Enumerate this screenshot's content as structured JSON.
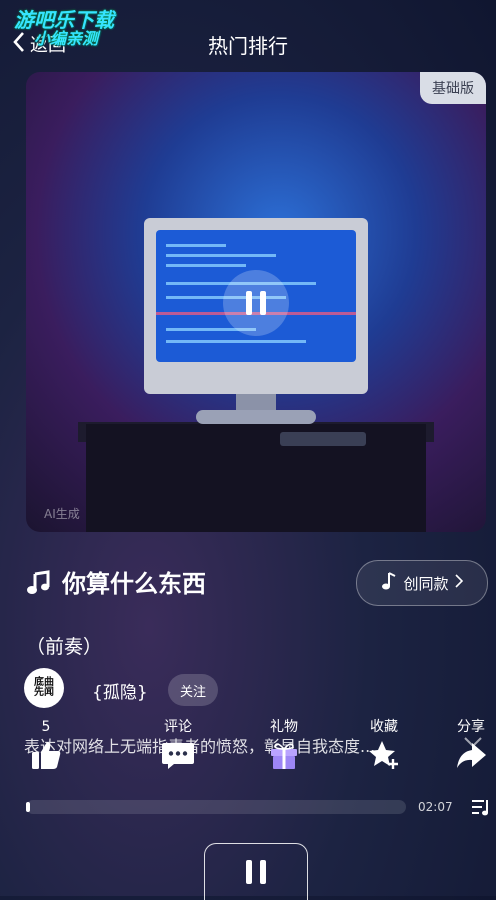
{
  "header": {
    "back_label": "返回",
    "title": "热门排行",
    "watermark_line1": "游吧乐下载",
    "watermark_line2": "小编亲测"
  },
  "cover": {
    "tier_badge": "基础版",
    "ai_label": "AI生成",
    "state": "playing"
  },
  "song": {
    "title": "你算什么东西",
    "same_style_label": "创同款",
    "section_tag": "（前奏）"
  },
  "artist": {
    "name": "{孤隐}",
    "avatar_text": "底曲先闻",
    "follow_label": "关注"
  },
  "description": "表达对网络上无端指责者的愤怒，彰显自我态度...",
  "actions": [
    {
      "label": "5",
      "icon": "thumbs-up-icon"
    },
    {
      "label": "评论",
      "icon": "comment-icon"
    },
    {
      "label": "礼物",
      "icon": "gift-icon"
    },
    {
      "label": "收藏",
      "icon": "star-plus-icon"
    },
    {
      "label": "分享",
      "icon": "share-icon"
    }
  ],
  "player": {
    "time": "02:07",
    "progress": 0.01
  },
  "colors": {
    "background": "#101630",
    "accent": "#2c6fd6",
    "badge_bg": "#d9dde6"
  }
}
